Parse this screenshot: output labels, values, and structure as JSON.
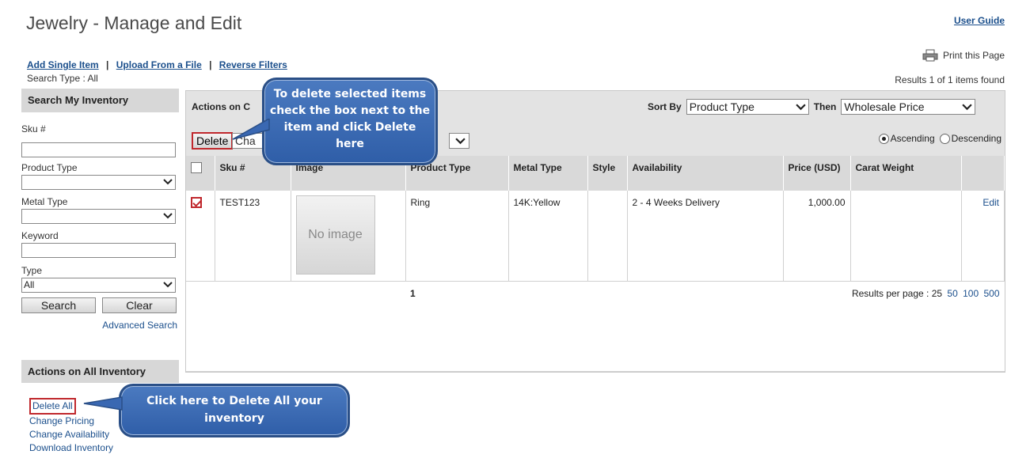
{
  "page": {
    "title": "Jewelry - Manage and Edit",
    "user_guide": "User Guide",
    "print": "Print this Page",
    "results_found": "Results 1 of 1 items found",
    "search_type": "Search Type : All"
  },
  "top_links": {
    "add_single": "Add Single Item",
    "upload": "Upload From a File",
    "reverse": "Reverse Filters",
    "sep": "|"
  },
  "search_panel": {
    "header": "Search My Inventory",
    "sku_label": "Sku #",
    "sku_value": "",
    "product_type_label": "Product Type",
    "product_type_value": "",
    "metal_type_label": "Metal Type",
    "metal_type_value": "",
    "keyword_label": "Keyword",
    "keyword_value": "",
    "type_label": "Type",
    "type_value": "All",
    "search_btn": "Search",
    "clear_btn": "Clear",
    "advanced": "Advanced Search"
  },
  "all_inventory": {
    "header": "Actions on All Inventory",
    "links": [
      "Delete All",
      "Change Pricing",
      "Change Availability",
      "Download Inventory"
    ]
  },
  "toolbar": {
    "actions_label": "Actions on C",
    "sort_by_label": "Sort By",
    "sort_by_value": "Product Type",
    "then_label": "Then",
    "then_value": "Wholesale Price",
    "delete_btn": "Delete",
    "change_value": "Cha",
    "ascending": "Ascending",
    "descending": "Descending"
  },
  "table": {
    "headers": [
      "Sku #",
      "Image",
      "Product Type",
      "Metal Type",
      "Style",
      "Availability",
      "Price (USD)",
      "Carat Weight",
      ""
    ],
    "row": {
      "sku": "TEST123",
      "image_text": "No image",
      "product_type": "Ring",
      "metal_type": "14K:Yellow",
      "style": "",
      "availability": "2 - 4 Weeks Delivery",
      "price": "1,000.00",
      "carat": "",
      "edit": "Edit"
    },
    "page_number": "1",
    "rpp_label": "Results per page : 25",
    "rpp_options": [
      "50",
      "100",
      "500"
    ]
  },
  "callouts": {
    "delete_selected": "To delete selected items check the box next to the item and click Delete here",
    "delete_all": "Click here to Delete All your inventory"
  }
}
